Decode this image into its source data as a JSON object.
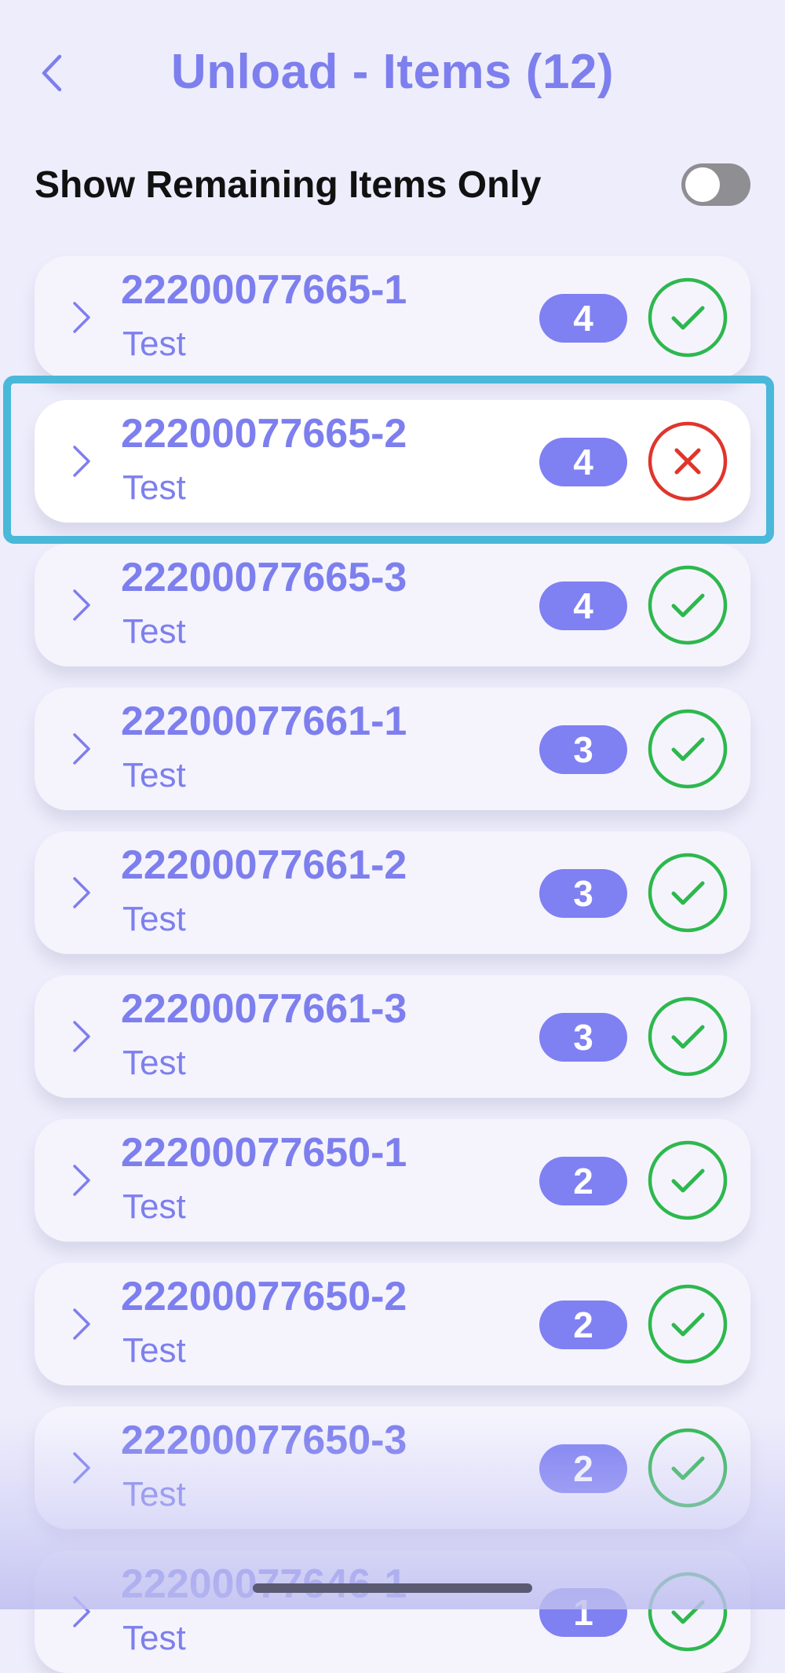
{
  "header": {
    "title": "Unload - Items (12)",
    "back_icon": "chevron-left-icon"
  },
  "filter": {
    "label": "Show Remaining Items Only",
    "toggle_on": false
  },
  "colors": {
    "accent": "#7d7fee",
    "badge": "#7f80f2",
    "success": "#2db84d",
    "error": "#e0352b",
    "highlight": "#4ab8d8"
  },
  "items": [
    {
      "id": "22200077665-1",
      "subtitle": "Test",
      "count": "4",
      "status": "done"
    },
    {
      "id": "22200077665-2",
      "subtitle": "Test",
      "count": "4",
      "status": "missing"
    },
    {
      "id": "22200077665-3",
      "subtitle": "Test",
      "count": "4",
      "status": "done"
    },
    {
      "id": "22200077661-1",
      "subtitle": "Test",
      "count": "3",
      "status": "done"
    },
    {
      "id": "22200077661-2",
      "subtitle": "Test",
      "count": "3",
      "status": "done"
    },
    {
      "id": "22200077661-3",
      "subtitle": "Test",
      "count": "3",
      "status": "done"
    },
    {
      "id": "22200077650-1",
      "subtitle": "Test",
      "count": "2",
      "status": "done"
    },
    {
      "id": "22200077650-2",
      "subtitle": "Test",
      "count": "2",
      "status": "done"
    },
    {
      "id": "22200077650-3",
      "subtitle": "Test",
      "count": "2",
      "status": "done"
    },
    {
      "id": "22200077646-1",
      "subtitle": "Test",
      "count": "1",
      "status": "done"
    }
  ],
  "selected_index": 1
}
